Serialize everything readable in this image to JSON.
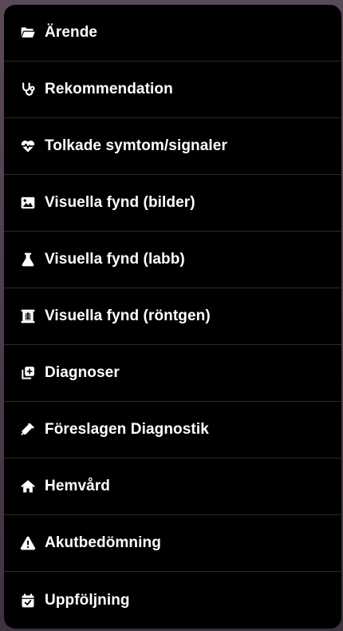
{
  "menu": {
    "items": [
      {
        "label": "Ärende",
        "icon": "folder-open-icon"
      },
      {
        "label": "Rekommendation",
        "icon": "stethoscope-icon"
      },
      {
        "label": "Tolkade symtom/signaler",
        "icon": "heart-pulse-icon"
      },
      {
        "label": "Visuella fynd (bilder)",
        "icon": "image-icon"
      },
      {
        "label": "Visuella fynd (labb)",
        "icon": "flask-icon"
      },
      {
        "label": "Visuella fynd (röntgen)",
        "icon": "x-ray-icon"
      },
      {
        "label": "Diagnoser",
        "icon": "notes-medical-icon"
      },
      {
        "label": "Föreslagen Diagnostik",
        "icon": "syringe-icon"
      },
      {
        "label": "Hemvård",
        "icon": "home-icon"
      },
      {
        "label": "Akutbedömning",
        "icon": "warning-icon"
      },
      {
        "label": "Uppföljning",
        "icon": "calendar-check-icon"
      }
    ]
  },
  "colors": {
    "menu_background": "#000000",
    "text": "#ffffff",
    "divider": "#2b2b2b"
  }
}
